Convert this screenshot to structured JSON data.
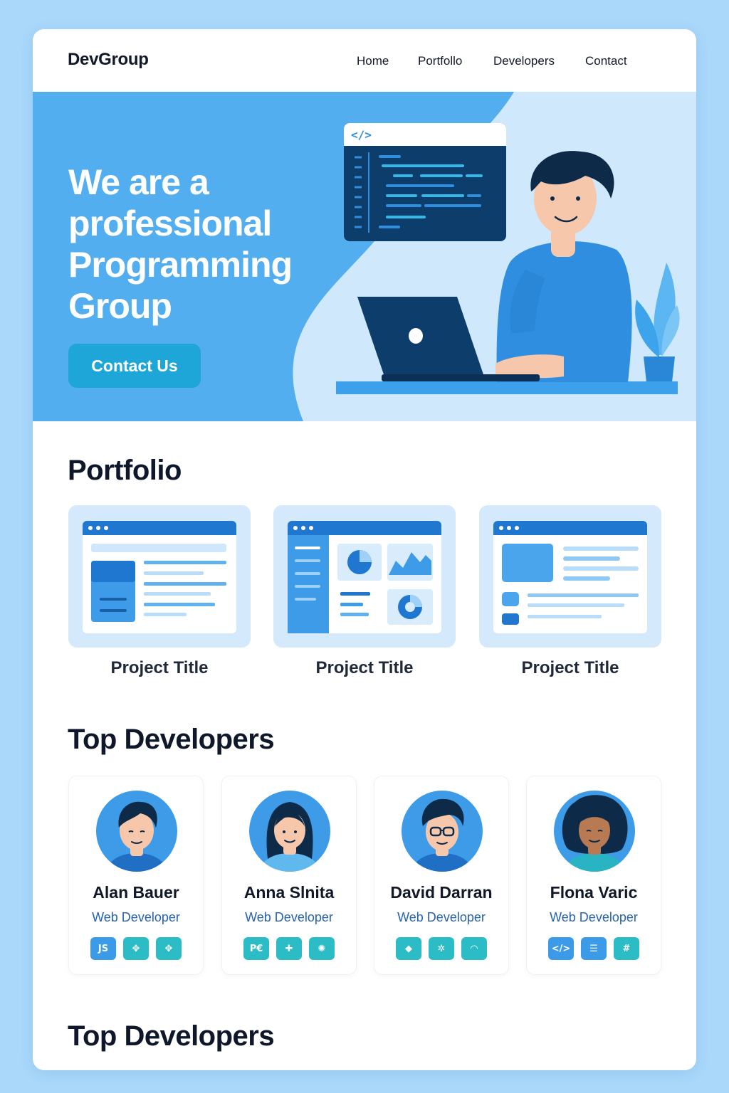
{
  "nav": {
    "logo": "DevGroup",
    "links": [
      "Home",
      "Portfollo",
      "Developers",
      "Contact"
    ]
  },
  "hero": {
    "title": "We are a professional Programming Group",
    "cta_label": "Contact Us"
  },
  "portfolio": {
    "heading": "Portfolio",
    "projects": [
      {
        "title": "Project Title"
      },
      {
        "title": "Project Title"
      },
      {
        "title": "Project Title"
      }
    ]
  },
  "developers": {
    "heading": "Top Developers",
    "items": [
      {
        "name": "Alan Bauer",
        "role": "Web Developer",
        "skills": [
          {
            "icon": "js-icon",
            "label": "JS"
          },
          {
            "icon": "puzzle-icon",
            "label": "✥"
          },
          {
            "icon": "puzzle-icon",
            "label": "✥"
          }
        ]
      },
      {
        "name": "Anna Slnita",
        "role": "Web Developer",
        "skills": [
          {
            "icon": "php-icon",
            "label": "P€"
          },
          {
            "icon": "cross-icon",
            "label": "✚"
          },
          {
            "icon": "brain-icon",
            "label": "✺"
          }
        ]
      },
      {
        "name": "David Darran",
        "role": "Web Developer",
        "skills": [
          {
            "icon": "git-icon",
            "label": "◆"
          },
          {
            "icon": "gear-icon",
            "label": "✲"
          },
          {
            "icon": "wifi-icon",
            "label": "◠"
          }
        ]
      },
      {
        "name": "Flona Varic",
        "role": "Web Developer",
        "skills": [
          {
            "icon": "code-icon",
            "label": "</>"
          },
          {
            "icon": "list-icon",
            "label": "☰"
          },
          {
            "icon": "hash-icon",
            "label": "#"
          }
        ]
      }
    ]
  },
  "footer_section": {
    "heading": "Top Developers"
  },
  "colors": {
    "page_bg": "#a9d8fa",
    "hero_blue": "#52aeef",
    "accent": "#1fa6d8",
    "dark_navy": "#0d3d6b"
  }
}
